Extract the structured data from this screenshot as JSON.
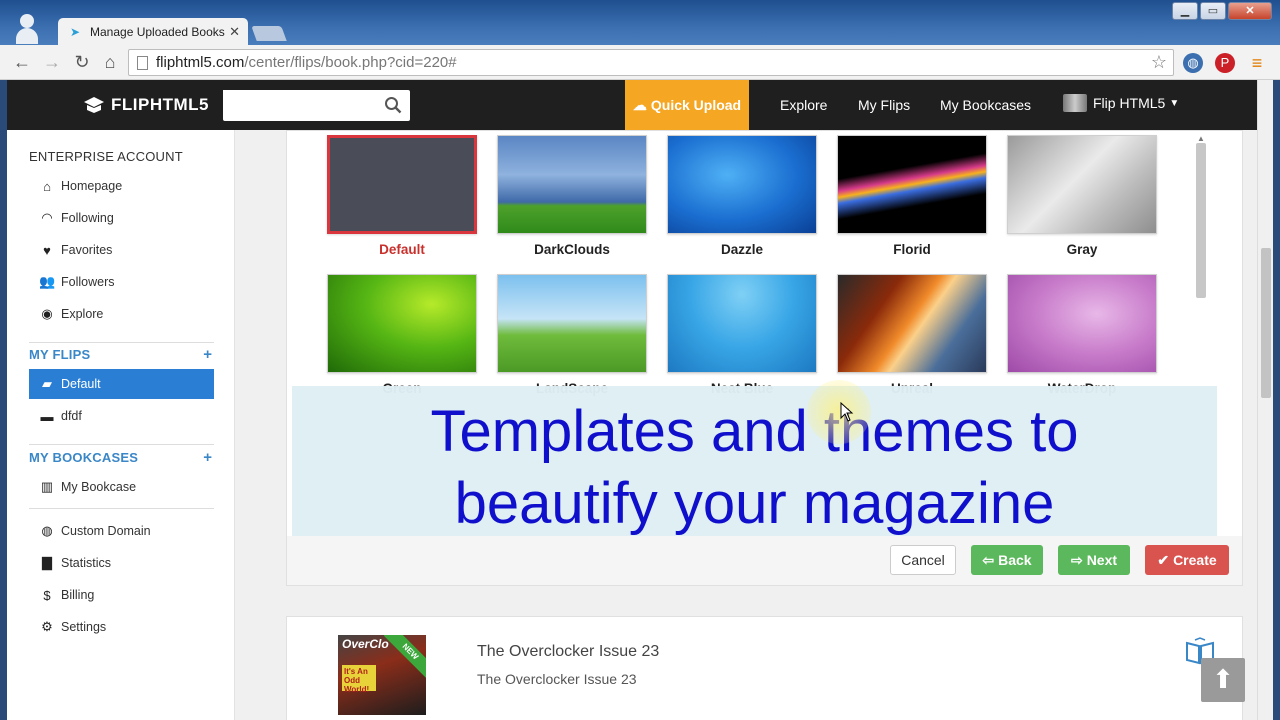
{
  "browser": {
    "tab_title": "Manage Uploaded Books",
    "url_host": "fliphtml5.com",
    "url_path": "/center/flips/book.php?cid=220#"
  },
  "header": {
    "logo_text": "FLIPHTML5",
    "search_placeholder": "",
    "quick_upload": "Quick Upload",
    "nav": [
      "Explore",
      "My Flips",
      "My Bookcases"
    ],
    "user_name": "Flip HTML5"
  },
  "sidebar": {
    "account_heading": "ENTERPRISE ACCOUNT",
    "account_items": [
      {
        "label": "Homepage",
        "icon": "home-icon"
      },
      {
        "label": "Following",
        "icon": "rss-icon"
      },
      {
        "label": "Favorites",
        "icon": "heart-icon"
      },
      {
        "label": "Followers",
        "icon": "users-icon"
      },
      {
        "label": "Explore",
        "icon": "eye-icon"
      }
    ],
    "flips_heading": "MY FLIPS",
    "flips_items": [
      {
        "label": "Default",
        "icon": "folder-open-icon",
        "active": true
      },
      {
        "label": "dfdf",
        "icon": "folder-icon",
        "active": false
      }
    ],
    "bookcases_heading": "MY BOOKCASES",
    "bookcases_items": [
      {
        "label": "My Bookcase",
        "icon": "bookcase-icon"
      }
    ],
    "other_items": [
      {
        "label": "Custom Domain",
        "icon": "globe-icon"
      },
      {
        "label": "Statistics",
        "icon": "bar-chart-icon"
      },
      {
        "label": "Billing",
        "icon": "dollar-icon"
      },
      {
        "label": "Settings",
        "icon": "gear-icon"
      }
    ]
  },
  "themes": [
    {
      "name": "Default",
      "selected": true
    },
    {
      "name": "DarkClouds",
      "selected": false
    },
    {
      "name": "Dazzle",
      "selected": false
    },
    {
      "name": "Florid",
      "selected": false
    },
    {
      "name": "Gray",
      "selected": false
    },
    {
      "name": "Green",
      "selected": false
    },
    {
      "name": "LandScape",
      "selected": false
    },
    {
      "name": "Neat Blue",
      "selected": false
    },
    {
      "name": "Unreal",
      "selected": false
    },
    {
      "name": "WaterDrop",
      "selected": false
    }
  ],
  "overlay": {
    "line1": "Templates and themes to",
    "line2": "beautify your magazine"
  },
  "actions": {
    "cancel": "Cancel",
    "back": "Back",
    "next": "Next",
    "create": "Create"
  },
  "book": {
    "title": "The Overclocker Issue 23",
    "subtitle": "The Overclocker Issue 23",
    "cover_title": "OverClo",
    "cover_world": "It's An Odd World!",
    "cover_badge": "NEW"
  },
  "colors": {
    "accent_blue": "#2a7fd4",
    "quick_upload": "#f5a623",
    "selected_border": "#d9363e",
    "success": "#5cb85c",
    "danger": "#d9534f",
    "overlay_text": "#1010cc"
  }
}
